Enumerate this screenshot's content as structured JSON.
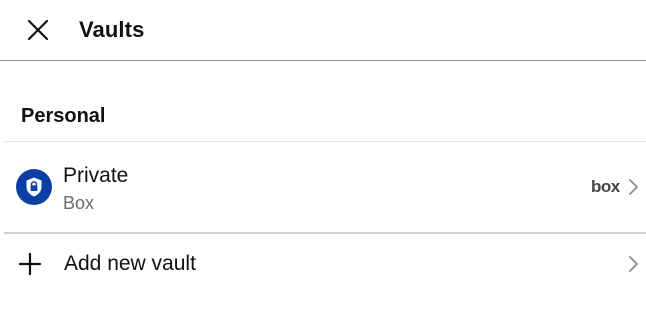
{
  "header": {
    "title": "Vaults"
  },
  "section": {
    "title": "Personal"
  },
  "vaults": [
    {
      "name": "Private",
      "provider": "Box",
      "provider_logo_text": "box",
      "avatar_color": "#0b3fa6"
    }
  ],
  "add_vault": {
    "label": "Add new vault"
  },
  "icons": {
    "close": "close-icon",
    "vault": "shield-lock-icon",
    "add": "plus-icon",
    "chevron": "chevron-right-icon"
  }
}
